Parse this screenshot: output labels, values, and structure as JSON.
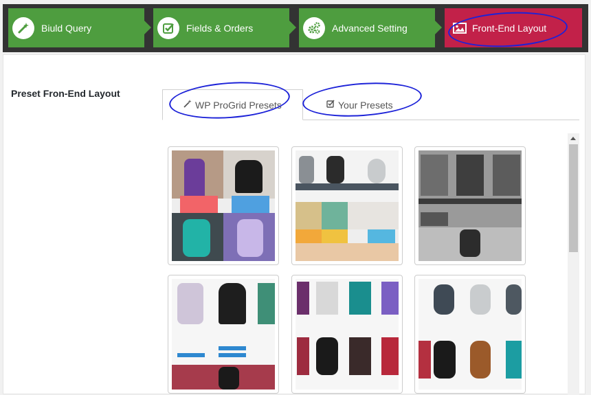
{
  "wizard": {
    "steps": [
      {
        "label": "Biuld Query",
        "icon": "wand-icon"
      },
      {
        "label": "Fields & Orders",
        "icon": "checkbox-icon"
      },
      {
        "label": "Advanced Setting",
        "icon": "gears-icon"
      },
      {
        "label": "Front-End Layout",
        "icon": "image-icon"
      }
    ],
    "active_step": 3,
    "colors": {
      "done": "#4e9d3f",
      "active": "#c22149",
      "bar": "#333333"
    }
  },
  "section": {
    "label": "Preset Fron-End Layout"
  },
  "tabs": [
    {
      "label": "WP ProGrid Presets",
      "icon": "wand-icon",
      "active": true
    },
    {
      "label": "Your Presets",
      "icon": "checkbox-icon",
      "active": false
    }
  ],
  "presets": [
    {
      "name": "preset-1"
    },
    {
      "name": "preset-2"
    },
    {
      "name": "preset-3"
    },
    {
      "name": "preset-4"
    },
    {
      "name": "preset-5"
    },
    {
      "name": "preset-6"
    }
  ]
}
